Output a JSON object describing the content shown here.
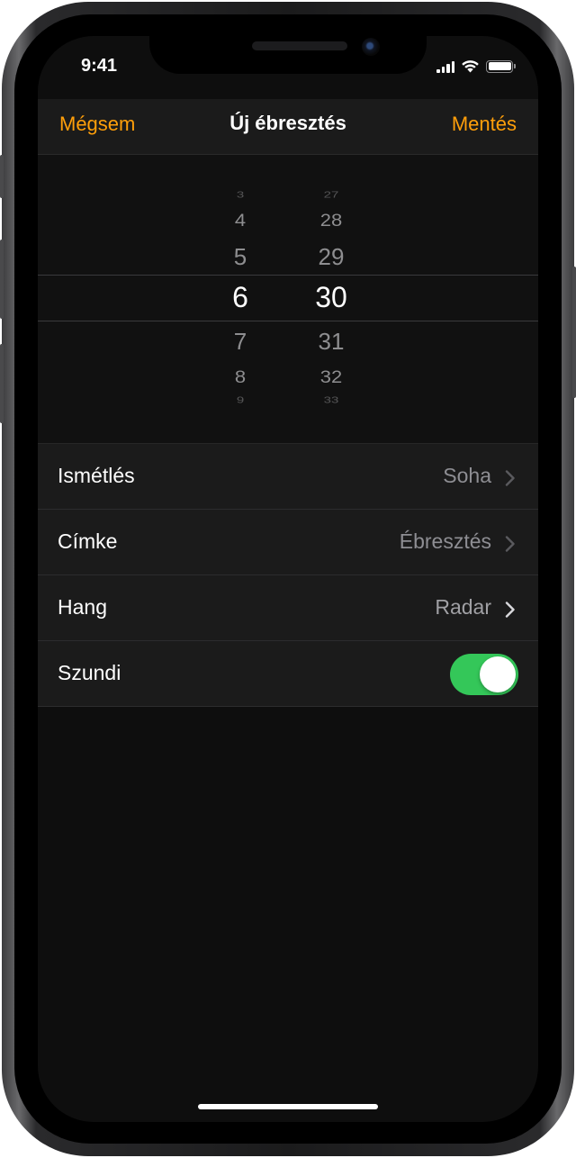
{
  "status_bar": {
    "time": "9:41"
  },
  "nav": {
    "cancel_label": "Mégsem",
    "title": "Új ébresztés",
    "save_label": "Mentés"
  },
  "picker": {
    "hours": [
      "3",
      "4",
      "5",
      "6",
      "7",
      "8",
      "9"
    ],
    "minutes": [
      "27",
      "28",
      "29",
      "30",
      "31",
      "32",
      "33"
    ],
    "selected_hour": "6",
    "selected_minute": "30"
  },
  "settings": {
    "repeat": {
      "label": "Ismétlés",
      "value": "Soha"
    },
    "label": {
      "label": "Címke",
      "value": "Ébresztés"
    },
    "sound": {
      "label": "Hang",
      "value": "Radar"
    },
    "snooze": {
      "label": "Szundi",
      "enabled": true
    }
  },
  "colors": {
    "accent": "#ff9f0a",
    "toggle_on": "#34c759",
    "background": "#0e0e0e"
  },
  "icons": {
    "chevron": "chevron-right-icon",
    "wifi": "wifi-icon",
    "signal": "cellular-signal-icon",
    "battery": "battery-icon"
  }
}
